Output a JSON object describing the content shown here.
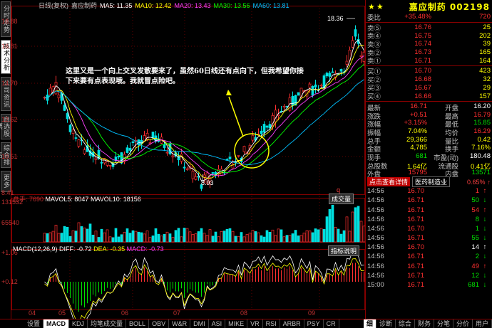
{
  "side_tabs": [
    "分时走势",
    "技术分析",
    "公司资讯",
    "自选股票",
    "综合排名",
    "更多"
  ],
  "header": {
    "period": "日线(复权)",
    "name": "嘉应制药",
    "ma": [
      {
        "t": "MA5: 11.35",
        "c": "#ffffff"
      },
      {
        "t": "MA10: 12.42",
        "c": "#ffff00"
      },
      {
        "t": "MA20: 13.43",
        "c": "#ff40ff"
      },
      {
        "t": "MA30: 13.56",
        "c": "#00ff00"
      },
      {
        "t": "MA60: 13.81",
        "c": "#00c0ff"
      }
    ]
  },
  "price_axis": [
    "18.88",
    "16.81",
    "14.70",
    "12.62",
    "10.51",
    "8.41"
  ],
  "vol_header": {
    "a": "总手: 7690",
    "b": "MAVOL5: 8047",
    "c": "MAVOL10: 18156"
  },
  "vol_axis": [
    "131532",
    "65540"
  ],
  "vol_btn": "成交量",
  "macd_header": {
    "a": "MACD(12,26,9)",
    "b": "DIFF: -0.72",
    "c": "DEA: -0.35",
    "d": "MACD: -0.73"
  },
  "macd_axis": [
    "+1.06",
    "+0.12"
  ],
  "macd_btn": "指标说明",
  "x_axis": [
    "04",
    "05",
    "06",
    "07",
    "08",
    "09"
  ],
  "high_mark": "18.36",
  "low_mark": "8.93",
  "q_mark": "q",
  "annotation": "这里又是一个向上交叉发散要来了，虽然60日线还有点向下，但我希望你接下来要有点表现哦。我就冒点险吧。",
  "panel": {
    "title": "嘉应制药 002198",
    "webi": {
      "l": "委比",
      "v": "+35.48%",
      "r": "720"
    },
    "asks": [
      {
        "l": "卖⑤",
        "p": "16.76",
        "q": "25"
      },
      {
        "l": "卖④",
        "p": "16.75",
        "q": "202"
      },
      {
        "l": "卖③",
        "p": "16.74",
        "q": "39"
      },
      {
        "l": "卖②",
        "p": "16.73",
        "q": "165"
      },
      {
        "l": "卖①",
        "p": "16.71",
        "q": "164"
      }
    ],
    "bids": [
      {
        "l": "买①",
        "p": "16.70",
        "q": "423"
      },
      {
        "l": "买②",
        "p": "16.68",
        "q": "32"
      },
      {
        "l": "买③",
        "p": "16.67",
        "q": "29"
      },
      {
        "l": "买④",
        "p": "16.66",
        "q": "157"
      }
    ],
    "stats": [
      {
        "a": "最新",
        "b": "16.71",
        "bc": "red",
        "c": "开盘",
        "d": "16.20",
        "dc": "wht"
      },
      {
        "a": "涨跌",
        "b": "+0.51",
        "bc": "red",
        "c": "最高",
        "d": "16.79",
        "dc": "red"
      },
      {
        "a": "涨幅",
        "b": "+3.15%",
        "bc": "red",
        "c": "最低",
        "d": "15.85",
        "dc": "grn"
      },
      {
        "a": "振幅",
        "b": "7.04%",
        "bc": "yel",
        "c": "均价",
        "d": "16.29",
        "dc": "red"
      },
      {
        "a": "总手",
        "b": "29,366",
        "bc": "yel",
        "c": "量比",
        "d": "0.42",
        "dc": "yel"
      },
      {
        "a": "金额",
        "b": "4,785",
        "bc": "yel",
        "c": "换手",
        "d": "7.16%",
        "dc": "yel"
      },
      {
        "a": "现手",
        "b": "681",
        "bc": "grn",
        "c": "市盈(动)",
        "d": "180.48",
        "dc": "wht"
      },
      {
        "a": "总股数",
        "b": "1.64亿",
        "bc": "yel",
        "c": "流通股",
        "d": "0.41亿",
        "dc": "yel"
      },
      {
        "a": "外盘",
        "b": "15795",
        "bc": "red",
        "c": "内盘",
        "d": "13571",
        "dc": "grn"
      }
    ],
    "news_btn": "点击查看详情",
    "industry": "医药制造业",
    "industry_pct": "0.65%",
    "ticks": [
      {
        "t": "14:56",
        "p": "16.70",
        "v": "1",
        "bs": "↑",
        "c": "red"
      },
      {
        "t": "14:56",
        "p": "16.71",
        "v": "50",
        "bs": "↓",
        "c": "grn"
      },
      {
        "t": "14:56",
        "p": "16.71",
        "v": "54",
        "bs": "↑",
        "c": "red"
      },
      {
        "t": "14:56",
        "p": "16.71",
        "v": "8",
        "bs": "↓",
        "c": "grn"
      },
      {
        "t": "14:56",
        "p": "16.70",
        "v": "1",
        "bs": "↓",
        "c": "grn"
      },
      {
        "t": "14:56",
        "p": "16.71",
        "v": "55",
        "bs": "↓",
        "c": "grn"
      },
      {
        "t": "14:56",
        "p": "16.70",
        "v": "14",
        "bs": "↑",
        "c": "wht"
      },
      {
        "t": "14:56",
        "p": "16.71",
        "v": "2",
        "bs": "↓",
        "c": "grn"
      },
      {
        "t": "14:56",
        "p": "16.71",
        "v": "49",
        "bs": "↑",
        "c": "red"
      },
      {
        "t": "14:56",
        "p": "16.71",
        "v": "12",
        "bs": "↓",
        "c": "grn"
      },
      {
        "t": "15:00",
        "p": "16.71",
        "v": "681",
        "bs": "↓",
        "c": "grn"
      }
    ]
  },
  "bottom_tabs": [
    "MACD",
    "KDJ",
    "均笔成交量",
    "BOLL",
    "OBV",
    "W&R",
    "DMI",
    "ASI",
    "MIKE",
    "VR",
    "RSI",
    "ARBR",
    "PSY",
    "CR"
  ],
  "bottom_left": "设置",
  "bottom_right": [
    "细",
    "诊断",
    "综合",
    "财务",
    "分笔",
    "分价",
    "用户"
  ],
  "colors": {
    "up": "#ff3030",
    "down": "#00e0e0",
    "ma5": "#ffffff",
    "ma10": "#ffff00",
    "ma20": "#ff40ff",
    "ma30": "#00ff00",
    "ma60": "#00c0ff"
  }
}
